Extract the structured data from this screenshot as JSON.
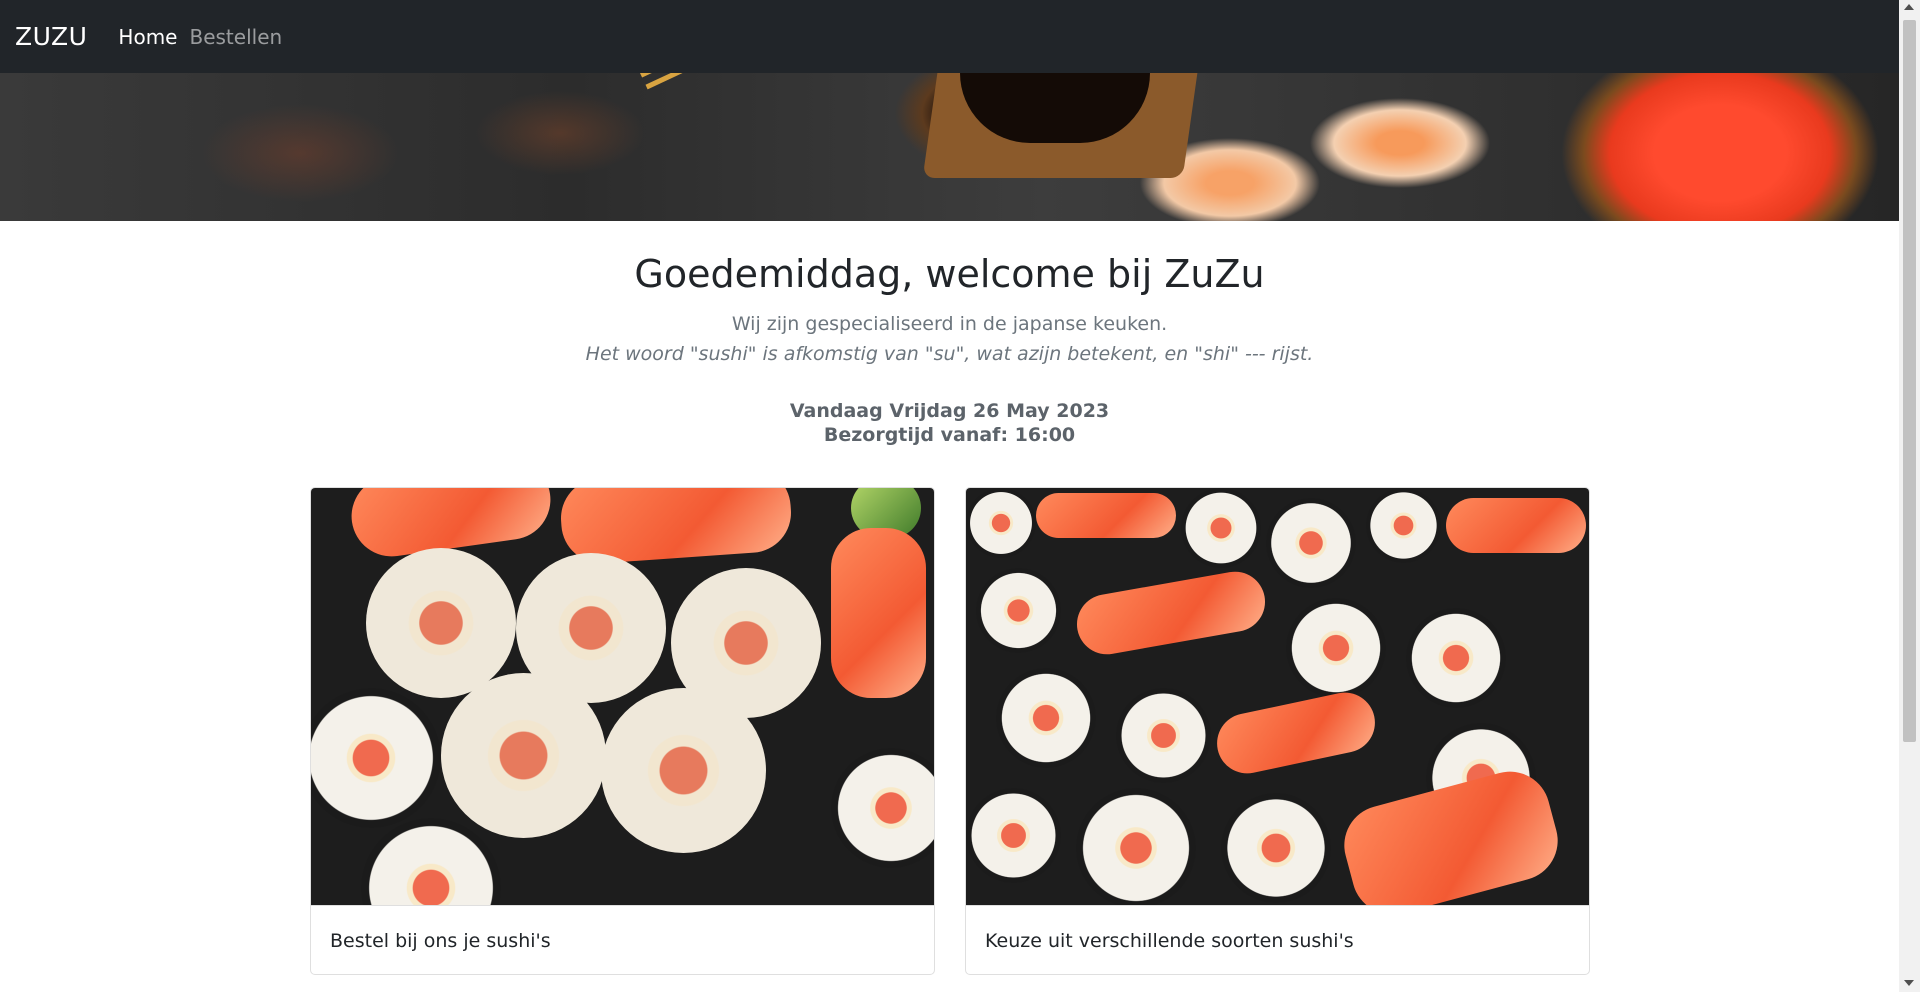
{
  "navbar": {
    "brand": "ZUZU",
    "links": [
      {
        "label": "Home",
        "active": true
      },
      {
        "label": "Bestellen",
        "active": false
      }
    ]
  },
  "hero": {
    "icon": "sushi-banner-image"
  },
  "main": {
    "greeting": "Goedemiddag, welcome bij ZuZu",
    "subtitle": "Wij zijn gespecialiseerd in de japanse keuken.",
    "subtitle_italic": "Het woord \"sushi\" is afkomstig van \"su\", wat azijn betekent, en \"shi\" --- rijst.",
    "date_line": "Vandaag Vrijdag 26 May 2023",
    "delivery_line": "Bezorgtijd vanaf: 16:00"
  },
  "cards": [
    {
      "text": "Bestel bij ons je sushi's",
      "image": "sushi-rolls-image"
    },
    {
      "text": "Keuze uit verschillende soorten sushi's",
      "image": "sushi-platter-image"
    }
  ],
  "colors": {
    "navbar_bg": "#212529",
    "text_primary": "#212529",
    "text_muted": "#6c757d"
  }
}
